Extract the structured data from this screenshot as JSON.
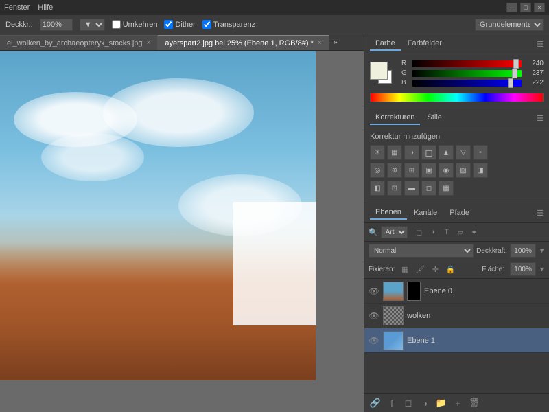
{
  "titlebar": {
    "menus": [
      "Fenster",
      "Hilfe"
    ],
    "controls": [
      "_",
      "□",
      "×"
    ]
  },
  "optionsbar": {
    "label": "Deckkr.:",
    "percent": "100%",
    "umkehren_label": "Umkehren",
    "dither_label": "Dither",
    "transparenz_label": "Transparenz",
    "grundelemente": "Grundelemente"
  },
  "tabs": [
    {
      "label": "el_wolken_by_archaeopteryx_stocks.jpg",
      "active": false
    },
    {
      "label": "ayerspart2.jpg bei 25% (Ebene 1, RGB/8#) *",
      "active": true
    }
  ],
  "color_panel": {
    "tabs": [
      "Farbe",
      "Farbfelder"
    ],
    "r_label": "R",
    "r_value": "240",
    "g_label": "G",
    "g_value": "237",
    "b_label": "B",
    "b_value": "222"
  },
  "korrekturen_panel": {
    "tabs": [
      "Korrekturen",
      "Stile"
    ],
    "add_label": "Korrektur hinzufügen",
    "icons": [
      "☀",
      "▦",
      "◑",
      "⬛",
      "◻",
      "▲",
      "▫",
      "◎",
      "⊕",
      "⊞",
      "▣",
      "◉",
      "▧",
      "◧",
      "◨",
      "⊡",
      "▬",
      "◻"
    ]
  },
  "ebenen_panel": {
    "tabs": [
      "Ebenen",
      "Kanäle",
      "Pfade"
    ],
    "search_placeholder": "Art",
    "blend_mode": "Normal",
    "opacity_label": "Deckkraft:",
    "opacity_value": "100%",
    "fixieren_label": "Fixieren:",
    "flache_label": "Fläche:",
    "flache_value": "100%",
    "layers": [
      {
        "name": "Ebene 0",
        "visible": true,
        "has_mask": true,
        "active": false,
        "thumb_type": "sky"
      },
      {
        "name": "wolken",
        "visible": true,
        "has_mask": false,
        "active": false,
        "thumb_type": "checker"
      },
      {
        "name": "Ebene 1",
        "visible": true,
        "has_mask": false,
        "active": true,
        "thumb_type": "blue"
      }
    ]
  }
}
